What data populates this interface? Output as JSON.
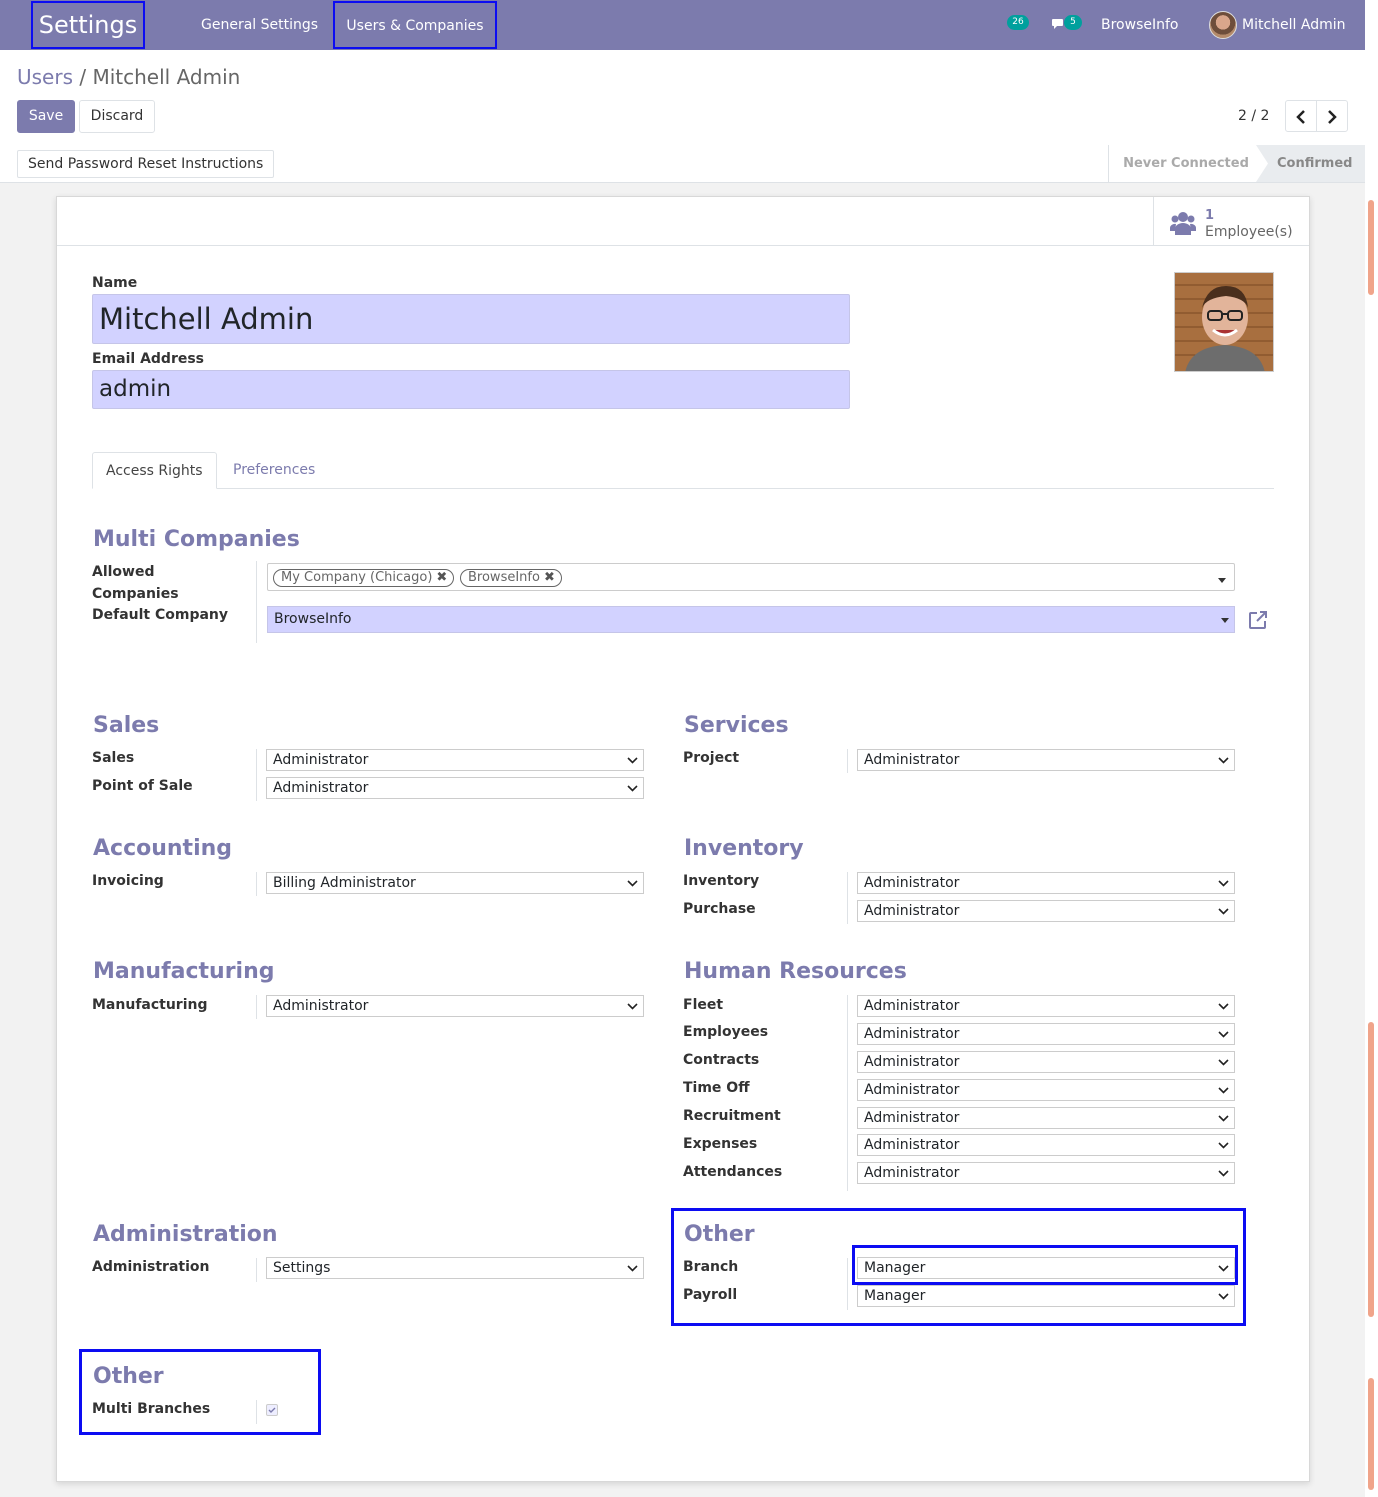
{
  "navbar": {
    "app_title": "Settings",
    "menu": [
      "General Settings",
      "Users & Companies"
    ],
    "activity_count": "26",
    "messages_count": "5",
    "company": "BrowseInfo",
    "user": "Mitchell Admin"
  },
  "breadcrumb": {
    "parent": "Users",
    "separator": " / ",
    "current": "Mitchell Admin"
  },
  "buttons": {
    "save": "Save",
    "discard": "Discard",
    "reset_password": "Send Password Reset Instructions"
  },
  "pager": {
    "value": "2 / 2"
  },
  "status": {
    "steps": [
      "Never Connected",
      "Confirmed"
    ],
    "active": "Confirmed"
  },
  "stat_button": {
    "value": "1",
    "label": "Employee(s)",
    "icon": "users-icon"
  },
  "form": {
    "name_label": "Name",
    "name_value": "Mitchell Admin",
    "email_label": "Email Address",
    "email_value": "admin"
  },
  "tabs": [
    "Access Rights",
    "Preferences"
  ],
  "multi_companies": {
    "title": "Multi Companies",
    "allowed_label_1": "Allowed",
    "allowed_label_2": "Companies",
    "allowed": [
      "My Company (Chicago)",
      "BrowseInfo"
    ],
    "default_label": "Default Company",
    "default_value": "BrowseInfo"
  },
  "groups": {
    "sales": {
      "title": "Sales",
      "rows": [
        {
          "label": "Sales",
          "value": "Administrator"
        },
        {
          "label": "Point of Sale",
          "value": "Administrator"
        }
      ]
    },
    "services": {
      "title": "Services",
      "rows": [
        {
          "label": "Project",
          "value": "Administrator"
        }
      ]
    },
    "accounting": {
      "title": "Accounting",
      "rows": [
        {
          "label": "Invoicing",
          "value": "Billing Administrator"
        }
      ]
    },
    "inventory": {
      "title": "Inventory",
      "rows": [
        {
          "label": "Inventory",
          "value": "Administrator"
        },
        {
          "label": "Purchase",
          "value": "Administrator"
        }
      ]
    },
    "manufacturing": {
      "title": "Manufacturing",
      "rows": [
        {
          "label": "Manufacturing",
          "value": "Administrator"
        }
      ]
    },
    "hr": {
      "title": "Human Resources",
      "rows": [
        {
          "label": "Fleet",
          "value": "Administrator"
        },
        {
          "label": "Employees",
          "value": "Administrator"
        },
        {
          "label": "Contracts",
          "value": "Administrator"
        },
        {
          "label": "Time Off",
          "value": "Administrator"
        },
        {
          "label": "Recruitment",
          "value": "Administrator"
        },
        {
          "label": "Expenses",
          "value": "Administrator"
        },
        {
          "label": "Attendances",
          "value": "Administrator"
        }
      ]
    },
    "administration": {
      "title": "Administration",
      "rows": [
        {
          "label": "Administration",
          "value": "Settings"
        }
      ]
    },
    "other": {
      "title": "Other",
      "rows": [
        {
          "label": "Branch",
          "value": "Manager"
        },
        {
          "label": "Payroll",
          "value": "Manager"
        }
      ]
    },
    "other2": {
      "title": "Other",
      "rows": [
        {
          "label": "Multi Branches",
          "checked": true
        }
      ]
    }
  },
  "colors": {
    "brand": "#7c7bad",
    "highlight": "#0c0cf2",
    "input_required": "#d2d2ff"
  }
}
